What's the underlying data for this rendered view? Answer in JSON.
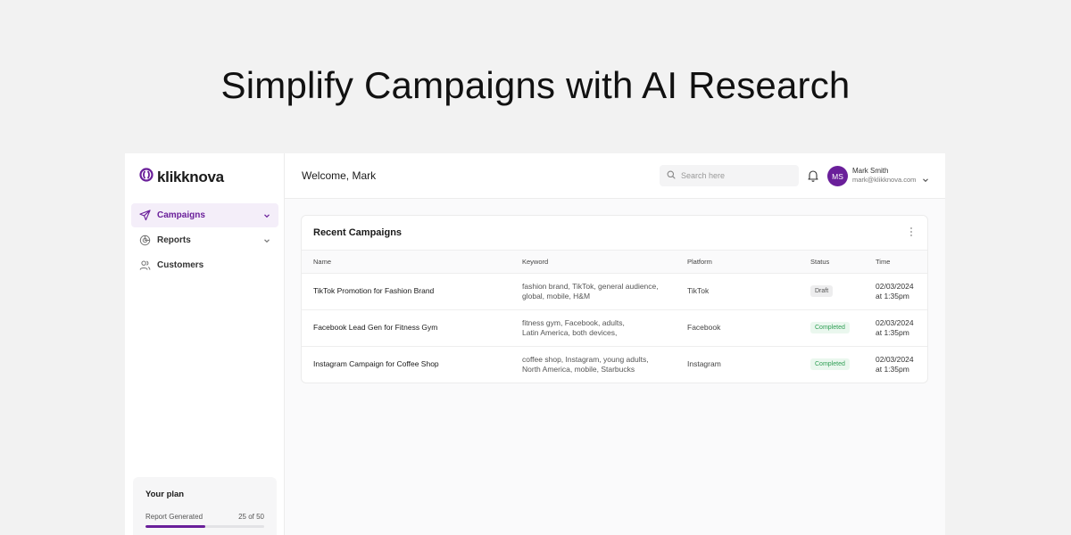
{
  "hero": {
    "title": "Simplify Campaigns with AI Research"
  },
  "colors": {
    "accent": "#6a1f9a",
    "draft": "#ededee",
    "completed": "#2f9e54"
  },
  "sidebar": {
    "logo": "klikknova",
    "items": [
      {
        "label": "Campaigns",
        "icon": "send-icon",
        "active": true,
        "has_chevron": true
      },
      {
        "label": "Reports",
        "icon": "chart-pie-icon",
        "active": false,
        "has_chevron": true
      },
      {
        "label": "Customers",
        "icon": "users-icon",
        "active": false,
        "has_chevron": false
      }
    ],
    "plan": {
      "title": "Your plan",
      "label": "Report Generated",
      "count_text": "25 of 50",
      "progress": 0.5
    }
  },
  "header": {
    "welcome": "Welcome, Mark",
    "search_placeholder": "Search here",
    "user": {
      "initials": "MS",
      "name": "Mark Smith",
      "email": "mark@klikknova.com"
    }
  },
  "campaigns": {
    "title": "Recent Campaigns",
    "columns": [
      "Name",
      "Keyword",
      "Platform",
      "Status",
      "Time"
    ],
    "rows": [
      {
        "name": "TikTok Promotion for Fashion Brand",
        "keyword_1": "fashion brand, TikTok, general audience,",
        "keyword_2": "global, mobile, H&M",
        "platform": "TikTok",
        "status": "Draft",
        "date": "02/03/2024",
        "time": "at 1:35pm"
      },
      {
        "name": "Facebook Lead Gen for Fitness Gym",
        "keyword_1": "fitness gym, Facebook, adults,",
        "keyword_2": "Latin America, both devices,",
        "platform": "Facebook",
        "status": "Completed",
        "date": "02/03/2024",
        "time": "at 1:35pm"
      },
      {
        "name": "Instagram Campaign for Coffee Shop",
        "keyword_1": "coffee shop, Instagram, young adults,",
        "keyword_2": "North America, mobile, Starbucks",
        "platform": "Instagram",
        "status": "Completed",
        "date": "02/03/2024",
        "time": "at 1:35pm"
      }
    ]
  }
}
